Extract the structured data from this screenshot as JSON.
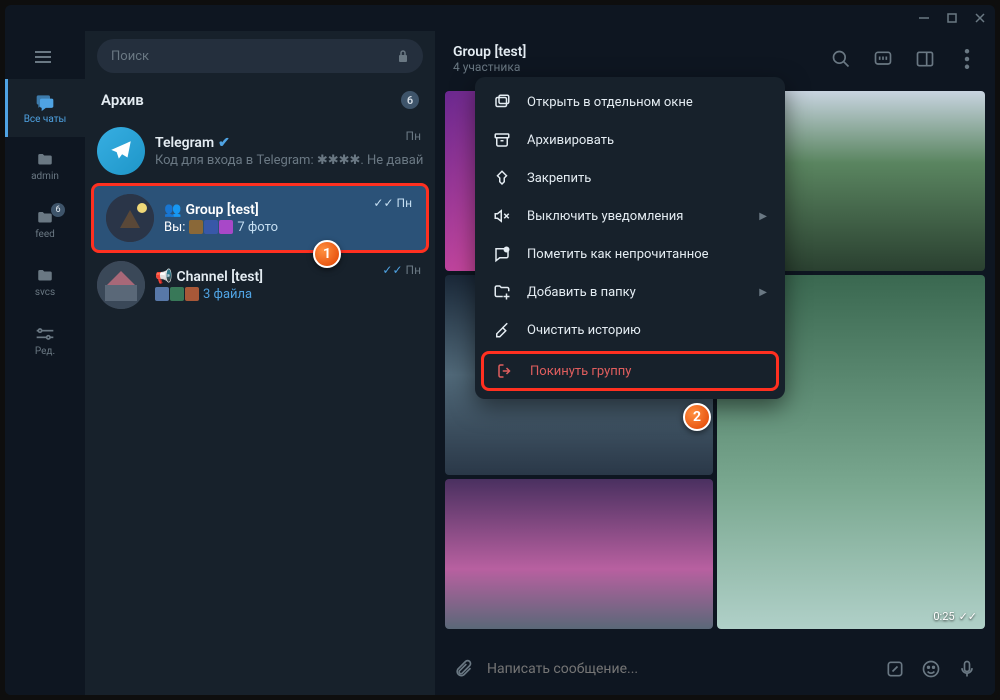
{
  "window": {
    "title": ""
  },
  "folders": {
    "items": [
      {
        "icon": "chat",
        "label": "Все чаты",
        "active": true
      },
      {
        "icon": "folder",
        "label": "admin"
      },
      {
        "icon": "folder",
        "label": "feed",
        "badge": "6"
      },
      {
        "icon": "folder",
        "label": "svcs"
      },
      {
        "icon": "settings",
        "label": "Ред."
      }
    ]
  },
  "search": {
    "placeholder": "Поиск"
  },
  "archive": {
    "label": "Архив",
    "count": "6"
  },
  "chats": [
    {
      "title": "Telegram",
      "verified": true,
      "preview": "Код для входа в Telegram: ✱✱✱✱. Не давайт...",
      "time": "Пн"
    },
    {
      "title": "Group [test]",
      "you": "Вы:",
      "preview_suffix": "7 фото",
      "time": "Пн",
      "checks": "✓✓",
      "selected": true,
      "grouptype": "group"
    },
    {
      "title": "Channel [test]",
      "preview_suffix": "3 файла",
      "time": "Пн",
      "checks": "✓✓",
      "grouptype": "channel",
      "link": true
    }
  ],
  "header": {
    "name": "Group [test]",
    "subtitle": "4 участника"
  },
  "context_menu": [
    {
      "icon": "popup",
      "label": "Открыть в отдельном окне"
    },
    {
      "icon": "archive",
      "label": "Архивировать"
    },
    {
      "icon": "pin",
      "label": "Закрепить"
    },
    {
      "icon": "mute",
      "label": "Выключить уведомления",
      "submenu": true
    },
    {
      "icon": "unread",
      "label": "Пометить как непрочитанное"
    },
    {
      "icon": "folder-add",
      "label": "Добавить в папку",
      "submenu": true
    },
    {
      "icon": "broom",
      "label": "Очистить историю"
    },
    {
      "icon": "leave",
      "label": "Покинуть группу",
      "danger": true
    }
  ],
  "markers": {
    "m1": "1",
    "m2": "2"
  },
  "gallery": {
    "video_time": "0:25"
  },
  "composer": {
    "placeholder": "Написать сообщение..."
  }
}
